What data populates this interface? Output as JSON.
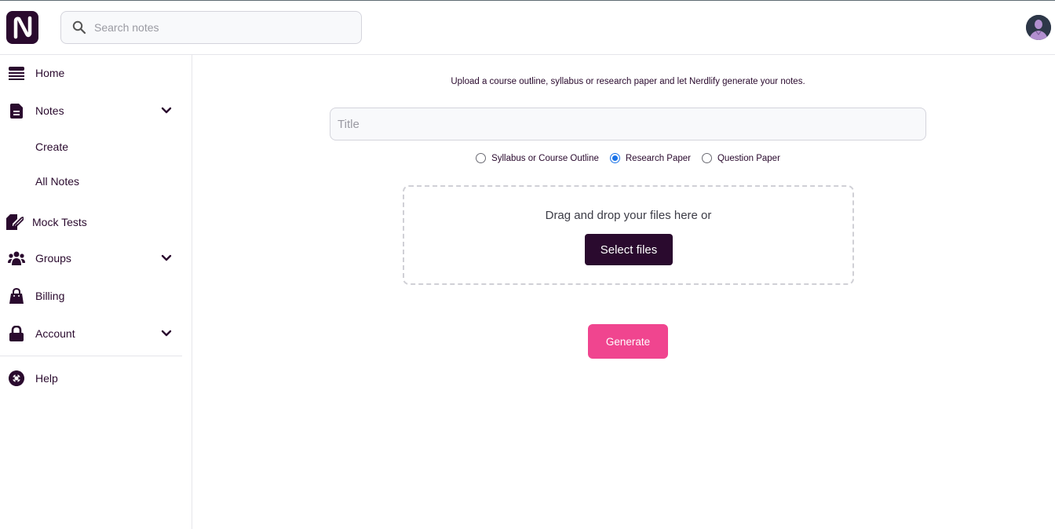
{
  "header": {
    "logo_letter": "N",
    "search": {
      "placeholder": "Search notes",
      "value": ""
    }
  },
  "sidebar": {
    "items": [
      {
        "id": "home",
        "label": "Home",
        "icon": "list-icon",
        "expandable": false
      },
      {
        "id": "notes",
        "label": "Notes",
        "icon": "document-icon",
        "expandable": true,
        "children": [
          {
            "label": "Create"
          },
          {
            "label": "All Notes"
          }
        ]
      },
      {
        "id": "mock-tests",
        "label": "Mock Tests",
        "icon": "pencil-paper-icon",
        "expandable": false
      },
      {
        "id": "groups",
        "label": "Groups",
        "icon": "users-icon",
        "expandable": true
      },
      {
        "id": "billing",
        "label": "Billing",
        "icon": "shopping-bag-icon",
        "expandable": false
      },
      {
        "id": "account",
        "label": "Account",
        "icon": "lock-icon",
        "expandable": true
      },
      {
        "id": "help",
        "label": "Help",
        "icon": "lifebuoy-icon",
        "expandable": false
      }
    ]
  },
  "main": {
    "intro": "Upload a course outline, syllabus or research paper and let Nerdlify generate your notes.",
    "title_input": {
      "placeholder": "Title",
      "value": ""
    },
    "doc_types": [
      {
        "label": "Syllabus or Course Outline",
        "selected": false
      },
      {
        "label": "Research Paper",
        "selected": true
      },
      {
        "label": "Question Paper",
        "selected": false
      }
    ],
    "dropzone_text": "Drag and drop your files here or",
    "select_files_label": "Select files",
    "generate_label": "Generate"
  },
  "colors": {
    "brand": "#2a0a2e",
    "accent": "#f0458f",
    "radio_selected": "#1a73e8"
  }
}
